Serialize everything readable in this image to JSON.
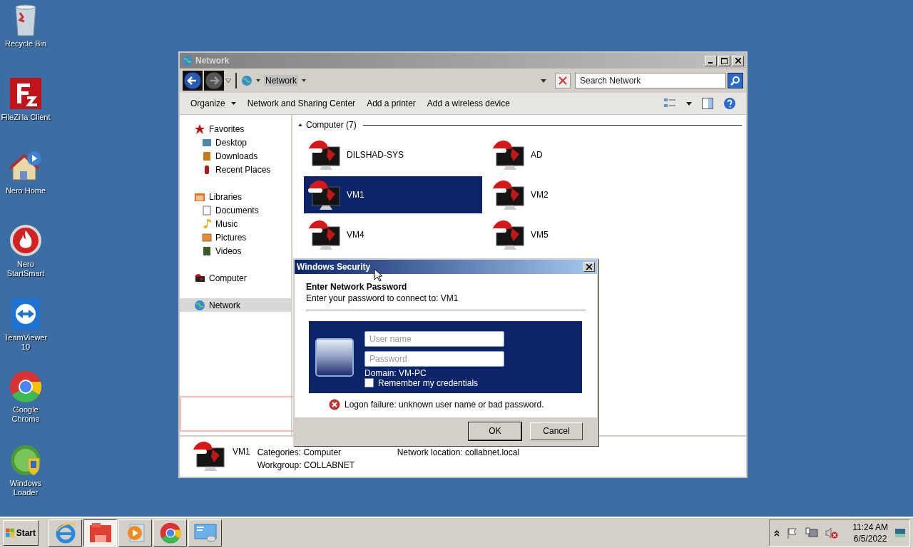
{
  "desktop_icons": [
    {
      "label": "Recycle Bin"
    },
    {
      "label": "FileZilla Client"
    },
    {
      "label": "Nero Home"
    },
    {
      "label": "Nero\nStartSmart"
    },
    {
      "label": "TeamViewer\n10"
    },
    {
      "label": "Google\nChrome"
    },
    {
      "label": "Windows\nLoader"
    }
  ],
  "window": {
    "title": "Network",
    "address": "Network",
    "search": {
      "placeholder": "Search Network"
    },
    "toolbar": [
      {
        "label": "Organize",
        "has_menu": true
      },
      {
        "label": "Network and Sharing Center",
        "has_menu": false
      },
      {
        "label": "Add a printer",
        "has_menu": false
      },
      {
        "label": "Add a wireless device",
        "has_menu": false
      }
    ],
    "sidebar": {
      "items": [
        {
          "label": "Favorites",
          "selected": false,
          "children": [
            {
              "label": "Desktop",
              "selected": false
            },
            {
              "label": "Downloads",
              "selected": false
            },
            {
              "label": "Recent Places",
              "selected": false
            }
          ]
        },
        {
          "label": "Libraries",
          "selected": false,
          "children": [
            {
              "label": "Documents",
              "selected": false
            },
            {
              "label": "Music",
              "selected": false
            },
            {
              "label": "Pictures",
              "selected": false
            },
            {
              "label": "Videos",
              "selected": false
            }
          ]
        },
        {
          "label": "Computer",
          "selected": false
        },
        {
          "label": "Network",
          "selected": true
        }
      ]
    },
    "group": {
      "label": "Computer (7)",
      "expanded": true
    },
    "computers": [
      {
        "name": "DILSHAD-SYS",
        "selected": false
      },
      {
        "name": "AD",
        "selected": false
      },
      {
        "name": "VM1",
        "selected": true
      },
      {
        "name": "VM2",
        "selected": false
      },
      {
        "name": "VM4",
        "selected": false
      },
      {
        "name": "VM5",
        "selected": false
      }
    ],
    "details": {
      "name": "VM1",
      "fields": [
        {
          "label": "Categories:",
          "value": "Computer"
        },
        {
          "label": "Workgroup:",
          "value": "COLLABNET"
        },
        {
          "label": "Network location:",
          "value": "collabnet.local"
        }
      ]
    }
  },
  "dialog": {
    "title": "Windows Security",
    "heading": "Enter Network Password",
    "subtitle": "Enter your password to connect to: VM1",
    "username": {
      "placeholder": "User name"
    },
    "password": {
      "placeholder": "Password"
    },
    "domain": "Domain: VM-PC",
    "remember": {
      "label": "Remember my credentials",
      "checked": false
    },
    "error": "Logon failure: unknown user name or bad password.",
    "buttons": [
      {
        "label": "OK",
        "default": true
      },
      {
        "label": "Cancel",
        "default": false
      }
    ]
  },
  "taskbar": {
    "start": "Start",
    "apps": [
      {
        "selected": false
      },
      {
        "selected": true
      },
      {
        "selected": false
      },
      {
        "selected": false
      },
      {
        "selected": false
      }
    ],
    "time": "11:24 AM",
    "date": "6/5/2022"
  }
}
